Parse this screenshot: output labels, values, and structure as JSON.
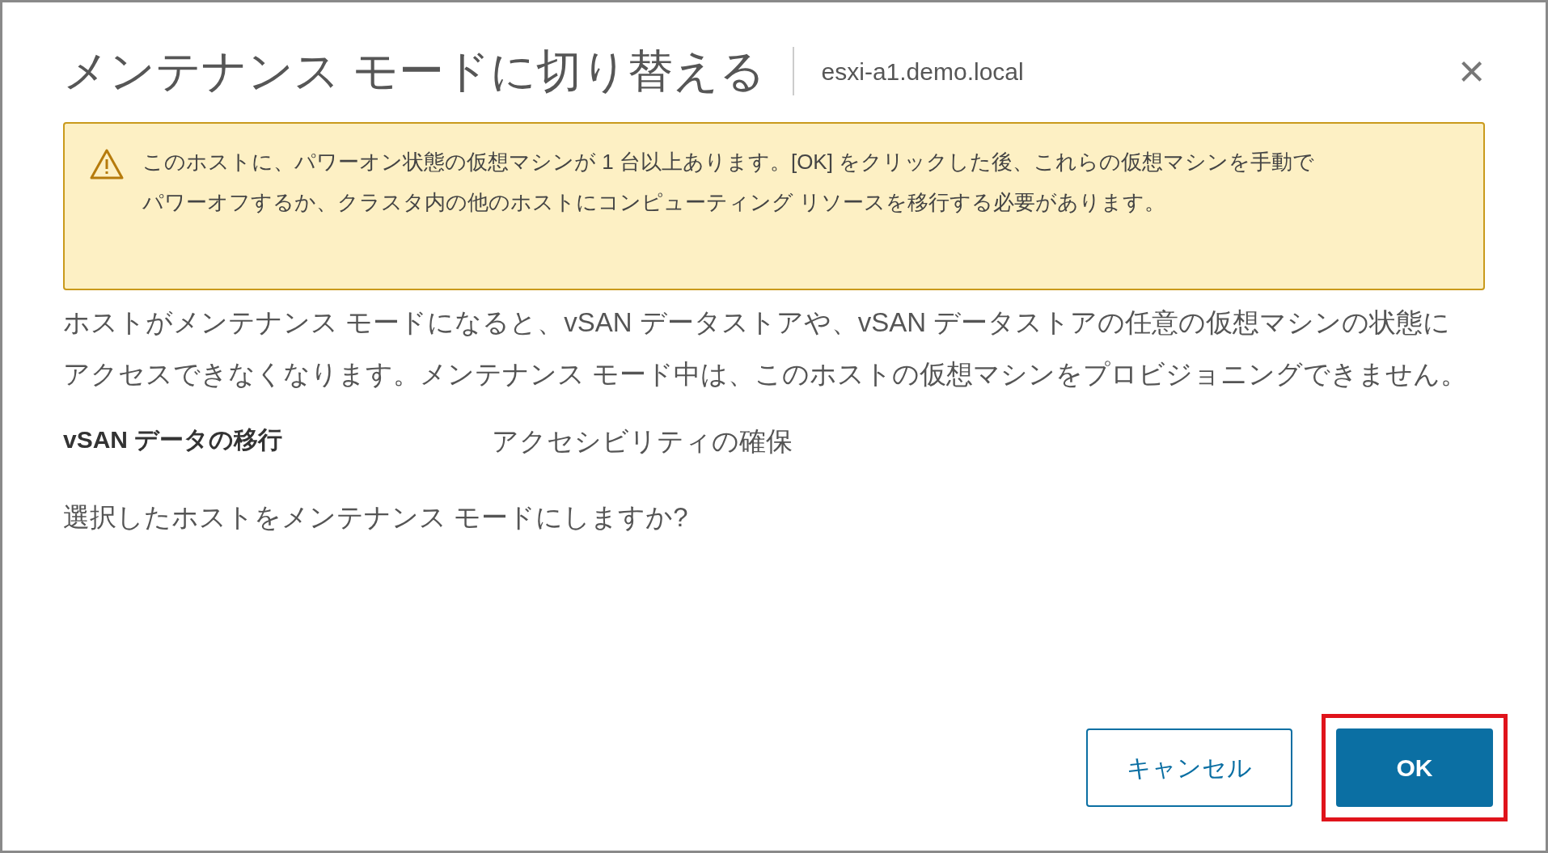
{
  "dialog": {
    "title": "メンテナンス モードに切り替える",
    "subtitle": "esxi-a1.demo.local",
    "close": "×"
  },
  "warning": {
    "text": "このホストに、パワーオン状態の仮想マシンが 1 台以上あります。[OK] をクリックした後、これらの仮想マシンを手動でパワーオフするか、クラスタ内の他のホストにコンピューティング リソースを移行する必要があります。"
  },
  "description": "ホストがメンテナンス モードになると、vSAN データストアや、vSAN データストアの任意の仮想マシンの状態にアクセスできなくなります。メンテナンス モード中は、このホストの仮想マシンをプロビジョニングできません。",
  "fields": [
    {
      "label": "vSAN データの移行",
      "value": "アクセシビリティの確保"
    }
  ],
  "question": "選択したホストをメンテナンス モードにしますか?",
  "buttons": [
    {
      "label": "キャンセル",
      "kind": "outline",
      "highlighted": false
    },
    {
      "label": "OK",
      "kind": "primary",
      "highlighted": true
    }
  ]
}
